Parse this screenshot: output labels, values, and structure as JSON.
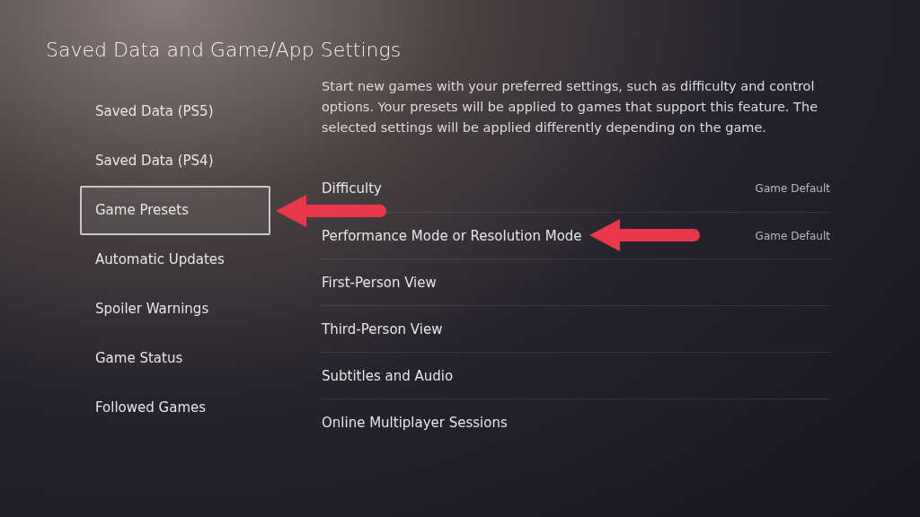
{
  "title": "Saved Data and Game/App Settings",
  "sidebar": {
    "items": [
      {
        "label": "Saved Data (PS5)",
        "selected": false,
        "annotated": false
      },
      {
        "label": "Saved Data (PS4)",
        "selected": false,
        "annotated": false
      },
      {
        "label": "Game Presets",
        "selected": true,
        "annotated": true
      },
      {
        "label": "Automatic Updates",
        "selected": false,
        "annotated": false
      },
      {
        "label": "Spoiler Warnings",
        "selected": false,
        "annotated": false
      },
      {
        "label": "Game Status",
        "selected": false,
        "annotated": false
      },
      {
        "label": "Followed Games",
        "selected": false,
        "annotated": false
      }
    ]
  },
  "description": "Start new games with your preferred settings, such as difficulty and control options. Your presets will be applied to games that support this feature. The selected settings will be applied differently depending on the game.",
  "settings": [
    {
      "label": "Difficulty",
      "value": "Game Default",
      "annotated": false
    },
    {
      "label": "Performance Mode or Resolution Mode",
      "value": "Game Default",
      "annotated": true
    },
    {
      "label": "First-Person View",
      "annotated": false
    },
    {
      "label": "Third-Person View",
      "annotated": false
    },
    {
      "label": "Subtitles and Audio",
      "annotated": false
    },
    {
      "label": "Online Multiplayer Sessions",
      "annotated": false
    }
  ]
}
